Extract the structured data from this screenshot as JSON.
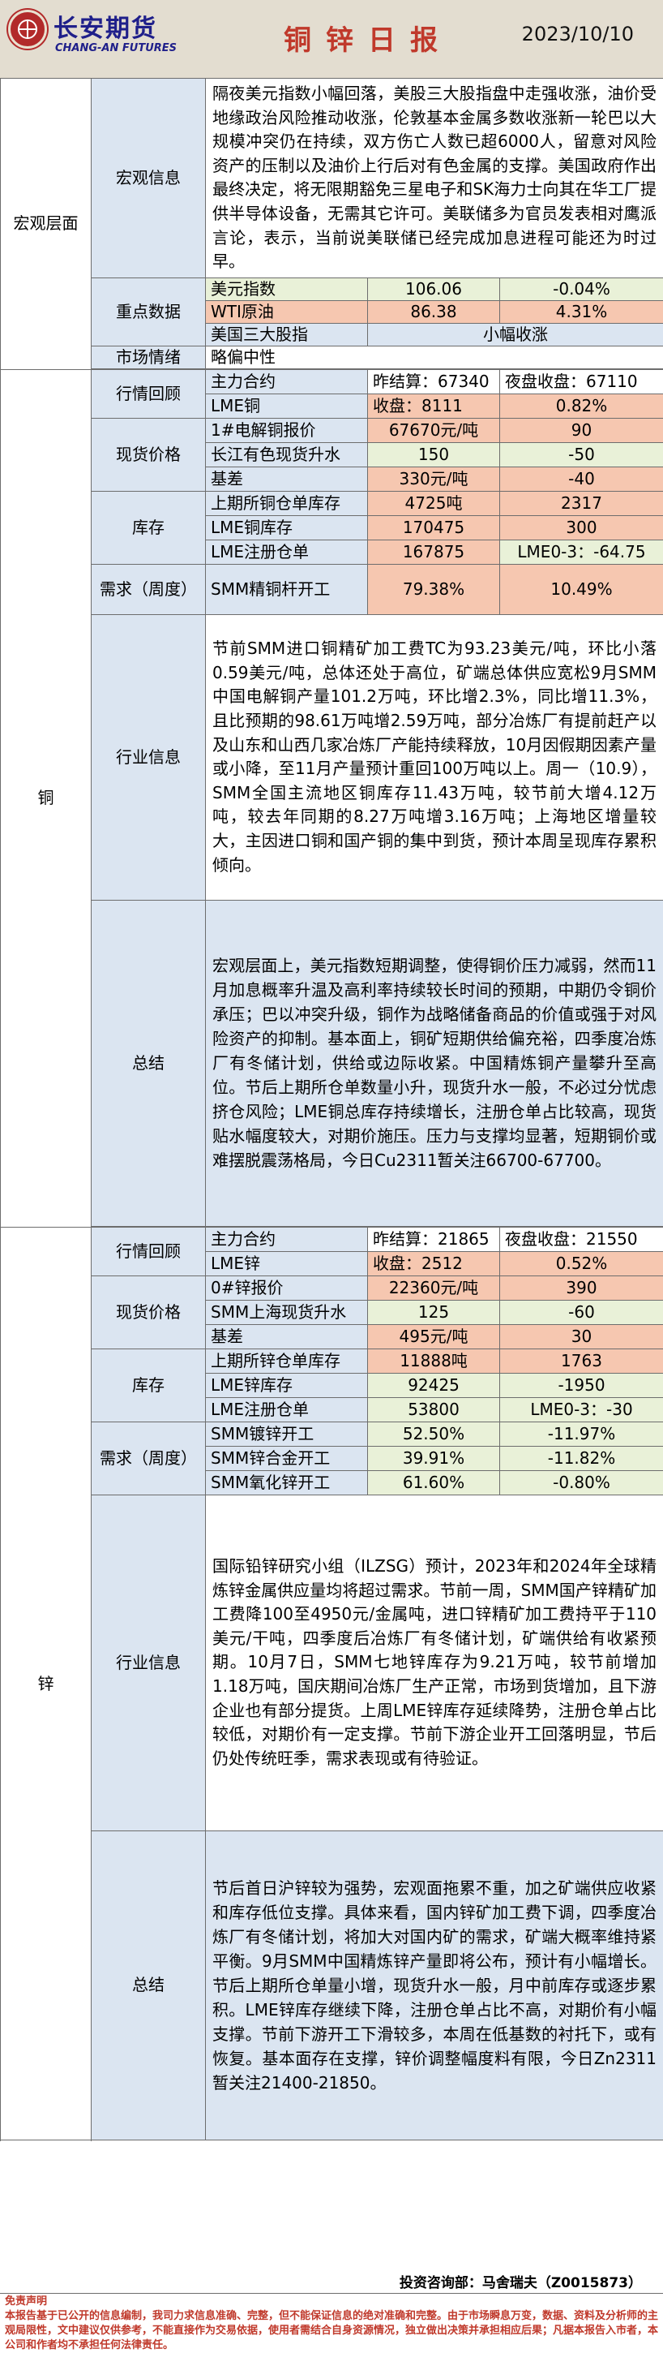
{
  "header": {
    "brand_cn": "长安期货",
    "brand_en": "CHANG-AN FUTURES",
    "title": "铜锌日报",
    "date": "2023/10/10"
  },
  "macro": {
    "section": "宏观层面",
    "info_label": "宏观信息",
    "info_text": "隔夜美元指数小幅回落，美股三大股指盘中走强收涨，油价受地缘政治风险推动收涨，伦敦基本金属多数收涨新一轮巴以大规模冲突仍在持续，双方伤亡人数已超6000人，留意对风险资产的压制以及油价上行后对有色金属的支撑。美国政府作出最终决定，将无限期豁免三星电子和SK海力士向其在华工厂提供半导体设备，无需其它许可。美联储多为官员发表相对鹰派言论，表示，当前说美联储已经完成加息进程可能还为时过早。",
    "key_label": "重点数据",
    "rows": [
      {
        "name": "美元指数",
        "value": "106.06",
        "change": "-0.04%"
      },
      {
        "name": "WTI原油",
        "value": "86.38",
        "change": "4.31%"
      },
      {
        "name": "美国三大股指",
        "value": "小幅收涨"
      }
    ],
    "sentiment_label": "市场情绪",
    "sentiment_value": "略偏中性"
  },
  "copper": {
    "section": "铜",
    "market": {
      "label": "行情回顾",
      "contract": "主力合约",
      "prev_settle": "昨结算：67340",
      "night_close": "夜盘收盘：67110",
      "lme_name": "LME铜",
      "lme_close": "收盘：8111",
      "lme_change": "0.82%"
    },
    "spot": {
      "label": "现货价格",
      "rows": [
        {
          "name": "1#电解铜报价",
          "value": "67670元/吨",
          "change": "90"
        },
        {
          "name": "长江有色现货升水",
          "value": "150",
          "change": "-50"
        },
        {
          "name": "基差",
          "value": "330元/吨",
          "change": "-40"
        }
      ]
    },
    "inventory": {
      "label": "库存",
      "rows": [
        {
          "name": "上期所铜仓单库存",
          "value": "4725吨",
          "change": "2317"
        },
        {
          "name": "LME铜库存",
          "value": "170475",
          "change": "300"
        },
        {
          "name": "LME注册仓单",
          "value": "167875",
          "change": "LME0-3：-64.75"
        }
      ]
    },
    "demand": {
      "label": "需求（周度）",
      "rows": [
        {
          "name": "SMM精铜杆开工",
          "value": "79.38%",
          "change": "10.49%"
        }
      ]
    },
    "industry": {
      "label": "行业信息",
      "text": "节前SMM进口铜精矿加工费TC为93.23美元/吨，环比小落0.59美元/吨，总体还处于高位，矿端总体供应宽松9月SMM中国电解铜产量101.2万吨，环比增2.3%，同比增11.3%，且比预期的98.61万吨增2.59万吨，部分冶炼厂有提前赶产以及山东和山西几家冶炼厂产能持续释放，10月因假期因素产量或小降，至11月产量预计重回100万吨以上。周一（10.9），SMM全国主流地区铜库存11.43万吨，较节前大增4.12万吨，较去年同期的8.27万吨增3.16万吨；上海地区增量较大，主因进口铜和国产铜的集中到货，预计本周呈现库存累积倾向。"
    },
    "summary": {
      "label": "总结",
      "text": "宏观层面上，美元指数短期调整，使得铜价压力减弱，然而11月加息概率升温及高利率持续较长时间的预期，中期仍令铜价承压；巴以冲突升级，铜作为战略储备商品的价值或强于对风险资产的抑制。基本面上，铜矿短期供给偏充裕，四季度冶炼厂有冬储计划，供给或边际收紧。中国精炼铜产量攀升至高位。节后上期所仓单数量小升，现货升水一般，不必过分忧虑挤仓风险；LME铜总库存持续增长，注册仓单占比较高，现货贴水幅度较大，对期价施压。压力与支撑均显著，短期铜价或难摆脱震荡格局，今日Cu2311暂关注66700-67700。"
    }
  },
  "zinc": {
    "section": "锌",
    "market": {
      "label": "行情回顾",
      "contract": "主力合约",
      "prev_settle": "昨结算：21865",
      "night_close": "夜盘收盘：21550",
      "lme_name": "LME锌",
      "lme_close": "收盘：2512",
      "lme_change": "0.52%"
    },
    "spot": {
      "label": "现货价格",
      "rows": [
        {
          "name": "0#锌报价",
          "value": "22360元/吨",
          "change": "390"
        },
        {
          "name": "SMM上海现货升水",
          "value": "125",
          "change": "-60"
        },
        {
          "name": "基差",
          "value": "495元/吨",
          "change": "30"
        }
      ]
    },
    "inventory": {
      "label": "库存",
      "rows": [
        {
          "name": "上期所锌仓单库存",
          "value": "11888吨",
          "change": "1763"
        },
        {
          "name": "LME锌库存",
          "value": "92425",
          "change": "-1950"
        },
        {
          "name": "LME注册仓单",
          "value": "53800",
          "change": "LME0-3：-30"
        }
      ]
    },
    "demand": {
      "label": "需求（周度）",
      "rows": [
        {
          "name": "SMM镀锌开工",
          "value": "52.50%",
          "change": "-11.97%"
        },
        {
          "name": "SMM锌合金开工",
          "value": "39.91%",
          "change": "-11.82%"
        },
        {
          "name": "SMM氧化锌开工",
          "value": "61.60%",
          "change": "-0.80%"
        }
      ]
    },
    "industry": {
      "label": "行业信息",
      "text": "国际铅锌研究小组（ILZSG）预计，2023年和2024年全球精炼锌金属供应量均将超过需求。节前一周，SMM国产锌精矿加工费降100至4950元/金属吨，进口锌精矿加工费持平于110美元/干吨，四季度后冶炼厂有冬储计划，矿端供给有收紧预期。10月7日，SMM七地锌库存为9.21万吨，较节前增加1.18万吨，国庆期间冶炼厂生产正常，市场到货增加，且下游企业也有部分提货。上周LME锌库存延续降势，注册仓单占比较低，对期价有一定支撑。节前下游企业开工回落明显，节后仍处传统旺季，需求表现或有待验证。"
    },
    "summary": {
      "label": "总结",
      "text": "节后首日沪锌较为强势，宏观面拖累不重，加之矿端供应收紧和库存低位支撑。具体来看，国内锌矿加工费下调，四季度冶炼厂有冬储计划，将加大对国内矿的需求，矿端大概率维持紧平衡。9月SMM中国精炼锌产量即将公布，预计有小幅增长。节后上期所仓单量小增，现货升水一般，月中前库存或逐步累积。LME锌库存继续下降，注册仓单占比不高，对期价有小幅支撑。节前下游开工下滑较多，本周在低基数的衬托下，或有恢复。基本面存在支撑，锌价调整幅度料有限，今日Zn2311暂关注21400-21850。"
    }
  },
  "footer": {
    "credit": "投资咨询部：马舍瑞夫（Z0015873）",
    "disclaimer_title": "免责声明",
    "disclaimer_text": "本报告基于已公开的信息编制，我司力求信息准确、完整，但不能保证信息的绝对准确和完整。由于市场瞬息万变，数据、资料及分析师的主观局限性，文中建议仅供参考，不能直接作为交易依据，使用者需结合自身资源情况，独立做出决策并承担相应后果；凡据本报告入市者，本公司和作者均不承担任何法律责任。"
  }
}
